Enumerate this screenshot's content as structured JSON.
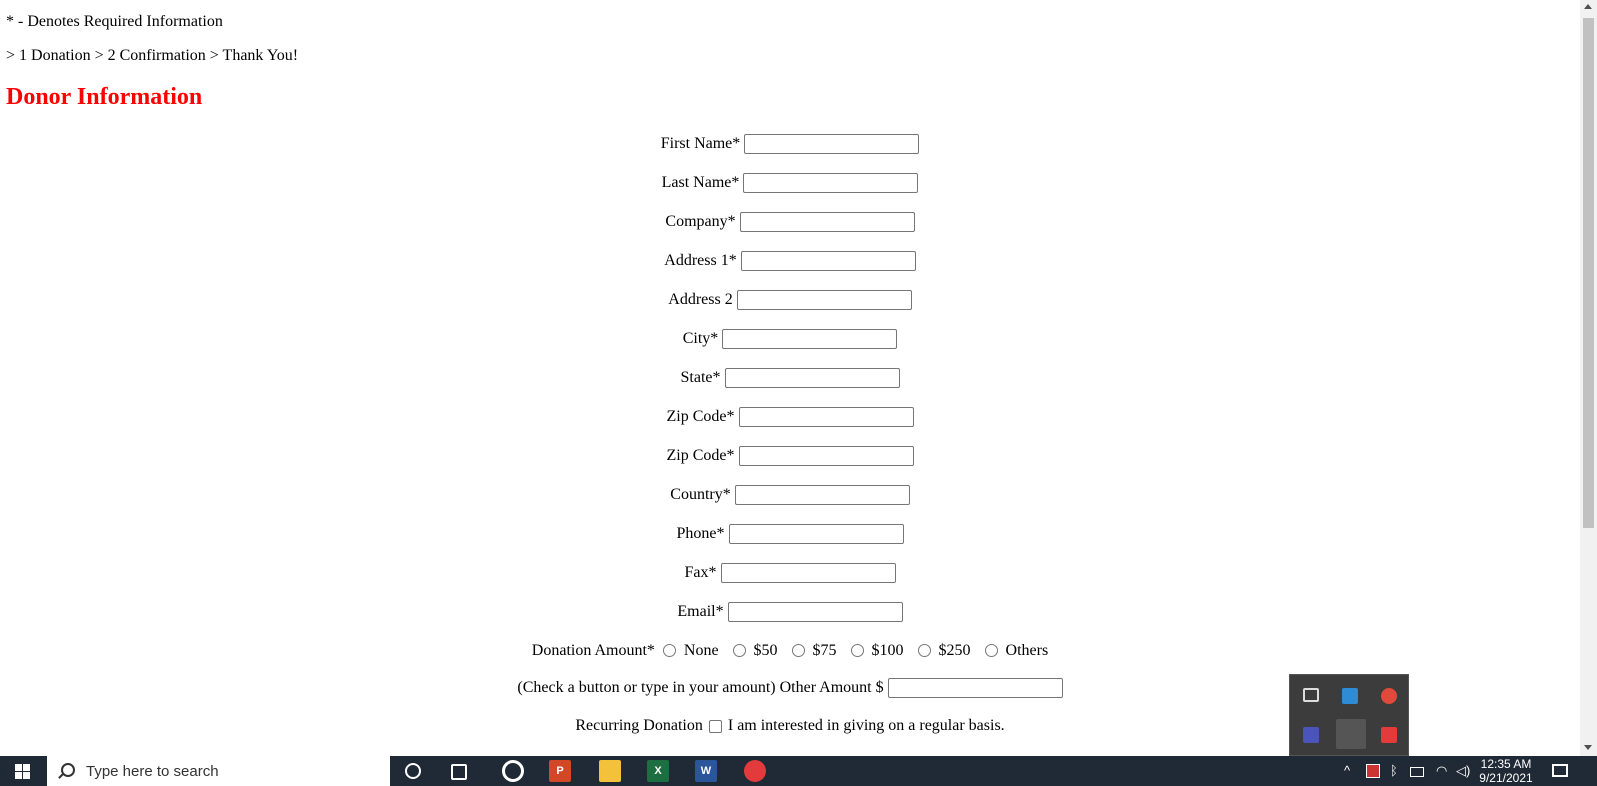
{
  "page": {
    "required_note": "* - Denotes Required Information",
    "steps": "> 1 Donation > 2 Confirmation > Thank You!",
    "heading": "Donor Information",
    "accent_color": "#ff0000"
  },
  "form": {
    "fields": [
      {
        "label": "First Name*",
        "value": ""
      },
      {
        "label": "Last Name*",
        "value": ""
      },
      {
        "label": "Company*",
        "value": ""
      },
      {
        "label": "Address 1*",
        "value": ""
      },
      {
        "label": "Address 2",
        "value": ""
      },
      {
        "label": "City*",
        "value": ""
      },
      {
        "label": "State*",
        "value": ""
      },
      {
        "label": "Zip Code*",
        "value": ""
      },
      {
        "label": "Zip Code*",
        "value": ""
      },
      {
        "label": "Country*",
        "value": ""
      },
      {
        "label": "Phone*",
        "value": ""
      },
      {
        "label": "Fax*",
        "value": ""
      },
      {
        "label": "Email*",
        "value": ""
      }
    ],
    "donation_amount": {
      "label": "Donation Amount*",
      "options": [
        "None",
        "$50",
        "$75",
        "$100",
        "$250",
        "Others"
      ]
    },
    "other_amount": {
      "label": "(Check a button or type in your amount) Other Amount $",
      "value": ""
    },
    "recurring": {
      "label": "Recurring Donation",
      "checkbox_label": "I am interested in giving on a regular basis.",
      "checked": false
    }
  },
  "taskbar": {
    "search_placeholder": "Type here to search",
    "time": "12:35 AM",
    "date": "9/21/2021",
    "apps": [
      "cortana-icon",
      "task-view-icon",
      "chrome-like-icon",
      "powerpoint-icon",
      "file-explorer-icon",
      "excel-icon",
      "word-icon",
      "recorder-icon"
    ]
  }
}
